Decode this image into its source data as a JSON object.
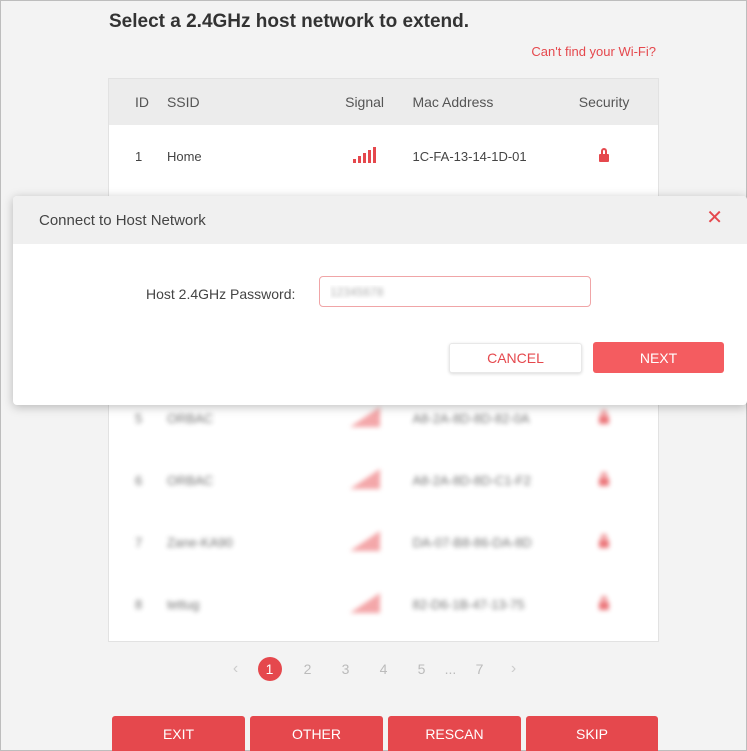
{
  "heading": "Select a 2.4GHz host network to extend.",
  "cant_find_link": "Can't find your Wi-Fi?",
  "table": {
    "headers": {
      "id": "ID",
      "ssid": "SSID",
      "signal": "Signal",
      "mac": "Mac Address",
      "security": "Security"
    },
    "rows": [
      {
        "id": "1",
        "ssid": "Home",
        "mac": "1C-FA-13-14-1D-01"
      },
      {
        "id": "5",
        "ssid": "ORBAC",
        "mac": "A8-2A-8D-8D-82-0A"
      },
      {
        "id": "6",
        "ssid": "ORBAC",
        "mac": "A8-2A-8D-8D-C1-F2"
      },
      {
        "id": "7",
        "ssid": "Zane-KA90",
        "mac": "DA-07-B8-86-DA-8D"
      },
      {
        "id": "8",
        "ssid": "tettug",
        "mac": "82-D6-1B-47-13-75"
      }
    ]
  },
  "modal": {
    "title": "Connect to Host Network",
    "password_label": "Host 2.4GHz Password:",
    "password_value": "12345678",
    "cancel_label": "CANCEL",
    "next_label": "NEXT"
  },
  "pagination": {
    "prev": "‹",
    "pages": [
      "1",
      "2",
      "3",
      "4",
      "5"
    ],
    "ellipsis": "...",
    "last": "7",
    "next": "›",
    "active": "1"
  },
  "bottom_buttons": {
    "exit": "EXIT",
    "other": "OTHER",
    "rescan": "RESCAN",
    "skip": "SKIP"
  },
  "colors": {
    "accent": "#e5484d",
    "button": "#f45c60"
  }
}
